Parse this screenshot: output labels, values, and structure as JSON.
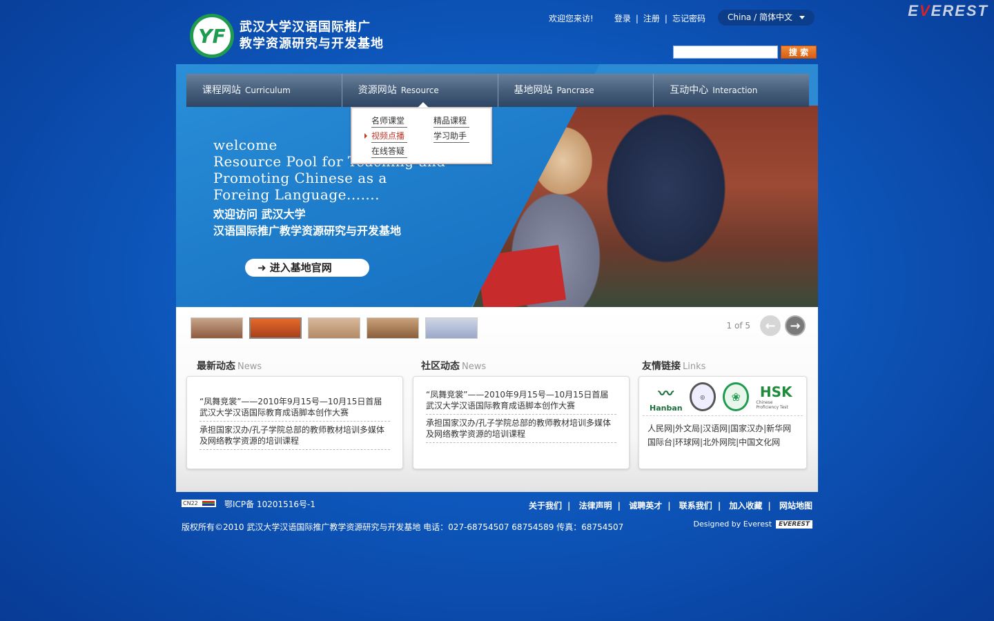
{
  "corner_brand": {
    "prefix": "E",
    "v": "V",
    "suffix": "EREST"
  },
  "header": {
    "logo_mark": "YF",
    "logo_line1": "武汉大学汉语国际推广",
    "logo_line2": "教学资源研究与开发基地",
    "welcome": "欢迎您来访!",
    "login": "登录",
    "register": "注册",
    "forgot": "忘记密码",
    "separator": "|",
    "language": "China / 简体中文",
    "search_button": "搜 索"
  },
  "nav": [
    {
      "cn": "课程网站",
      "en": "Curriculum"
    },
    {
      "cn": "资源网站",
      "en": "Resource"
    },
    {
      "cn": "基地网站",
      "en": "Pancrase"
    },
    {
      "cn": "互动中心",
      "en": "Interaction"
    }
  ],
  "dropdown": {
    "items": [
      "名师课堂",
      "精品课程",
      "视频点播",
      "学习助手",
      "在线答疑"
    ]
  },
  "banner": {
    "en_lines": [
      "welcome",
      "Resource Pool for Teaching and",
      "Promoting Chinese as a",
      "Foreing Language......."
    ],
    "cn_line1": "欢迎访问  武汉大学",
    "cn_line2": "汉语国际推广教学资源研究与开发基地",
    "enter_button": "➜ 进入基地官网"
  },
  "slider": {
    "counter": "1 of 5",
    "prev": "←",
    "next": "→"
  },
  "news": {
    "title": "最新动态",
    "title_en": "News",
    "items": [
      "“凤舞竞裳”——2010年9月15号—10月15日首届武汉大学汉语国际教育成语脚本创作大赛",
      "承担国家汉办/孔子学院总部的教师教材培训多媒体及网络教学资源的培训课程"
    ]
  },
  "community": {
    "title": "社区动态",
    "title_en": "News",
    "items": [
      "“凤舞竞裳”——2010年9月15号—10月15日首届武汉大学汉语国际教育成语脚本创作大赛",
      "承担国家汉办/孔子学院总部的教师教材培训多媒体及网络教学资源的培训课程"
    ]
  },
  "links": {
    "title": "友情链接",
    "title_en": "Links",
    "logo_hanban": "Hanban",
    "logo_hsk": "HSK",
    "logo_hsk_sub": "Chinese Proficiency Test",
    "line1": "人民网|外文局|汉语网|国家汉办|新华网",
    "line2": "国际台|环球网|北外网院|中国文化网"
  },
  "footer": {
    "cnnic": "CN22",
    "icp": "鄂ICP备  10201516号-1",
    "links": [
      "关于我们",
      "法律声明",
      "诚聘英才",
      "联系我们",
      "加入收藏",
      "网站地图"
    ],
    "copyright": "版权所有©2010  武汉大学汉语国际推广教学资源研究与开发基地    电话：027-68754507    68754589  传真：68754507",
    "designed_by": "Designed by Everest",
    "designed_logo": "EVEREST"
  }
}
